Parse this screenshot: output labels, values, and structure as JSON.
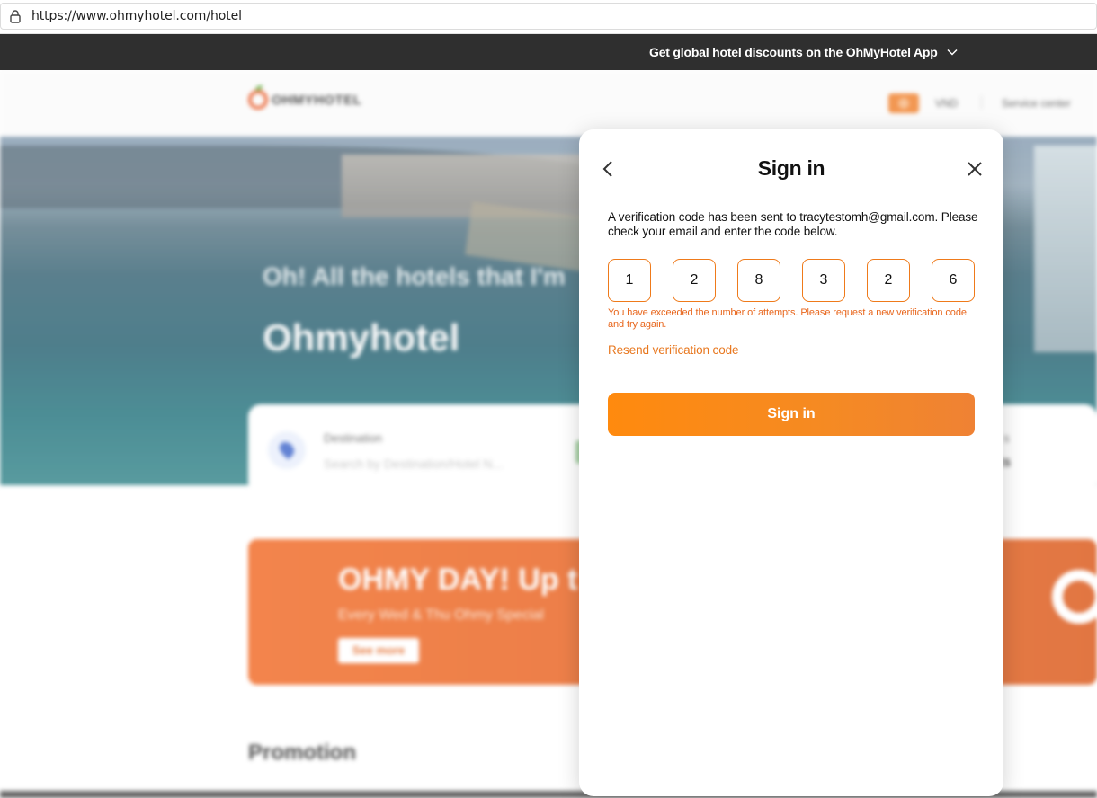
{
  "browser": {
    "url": "https://www.ohmyhotel.com/hotel",
    "lock_icon": "lock-icon"
  },
  "promo_bar": {
    "text": "Get global hotel discounts on the OhMyHotel App",
    "chevron_icon": "chevron-down-icon"
  },
  "site": {
    "logo_text": "OHMYHOTEL",
    "currency": "VND",
    "service_center": "Service center",
    "hero_line1": "Oh! All the hotels that I'm",
    "hero_line2": "Ohmyhotel",
    "search": {
      "destination_label": "Destination",
      "destination_placeholder": "Search by Destination/Hotel N...",
      "guests_label": "s",
      "guests_value": "dults"
    },
    "banner": {
      "title": "OHMY DAY! Up t",
      "subtitle": "Every Wed & Thu Ohmy Special",
      "button": "See more"
    },
    "promotion_heading": "Promotion"
  },
  "modal": {
    "title": "Sign in",
    "back_icon": "chevron-left-icon",
    "close_icon": "close-icon",
    "message": "A verification code has been sent to tracytestomh@gmail.com. Please check your email and enter the code below.",
    "code_digits": [
      "1",
      "2",
      "8",
      "3",
      "2",
      "6"
    ],
    "error": "You have exceeded the number of attempts. Please request a new verification code and try again.",
    "resend_label": "Resend verification code",
    "submit_label": "Sign in"
  },
  "colors": {
    "accent": "#F58A23",
    "error": "#E8661C",
    "promo_bar_bg": "#2F2F2F"
  }
}
